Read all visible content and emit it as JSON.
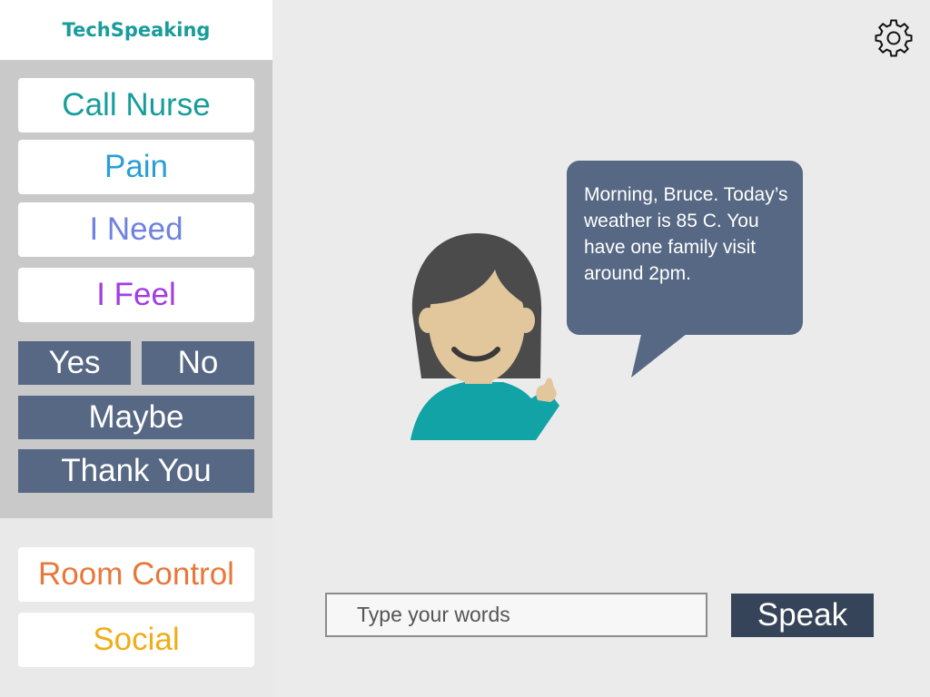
{
  "app": {
    "brand": "TechSpeaking"
  },
  "sidebar": {
    "quick": [
      {
        "label": "Call Nurse",
        "color": "#179d9b"
      },
      {
        "label": "Pain",
        "color": "#2a9fd6"
      },
      {
        "label": "I Need",
        "color": "#6f82de"
      },
      {
        "label": "I Feel",
        "color": "#a23de0"
      }
    ],
    "answers": {
      "yes": "Yes",
      "no": "No",
      "maybe": "Maybe",
      "thank_you": "Thank You"
    },
    "bottom": [
      {
        "label": "Room Control",
        "color": "#e8773a"
      },
      {
        "label": "Social",
        "color": "#f0ad16"
      }
    ]
  },
  "main": {
    "message": "Morning, Bruce. Today’s weather is 85 C. You have one family visit around 2pm.",
    "input": {
      "placeholder": "Type your words",
      "value": ""
    },
    "speak_label": "Speak"
  },
  "icons": {
    "settings": "gear-icon",
    "avatar": "assistant-avatar"
  },
  "colors": {
    "bubble": "#566883",
    "speak_button": "#354458",
    "avatar_shirt": "#11a3a6",
    "avatar_hair": "#4b4b4b",
    "avatar_skin": "#e2c79d"
  }
}
